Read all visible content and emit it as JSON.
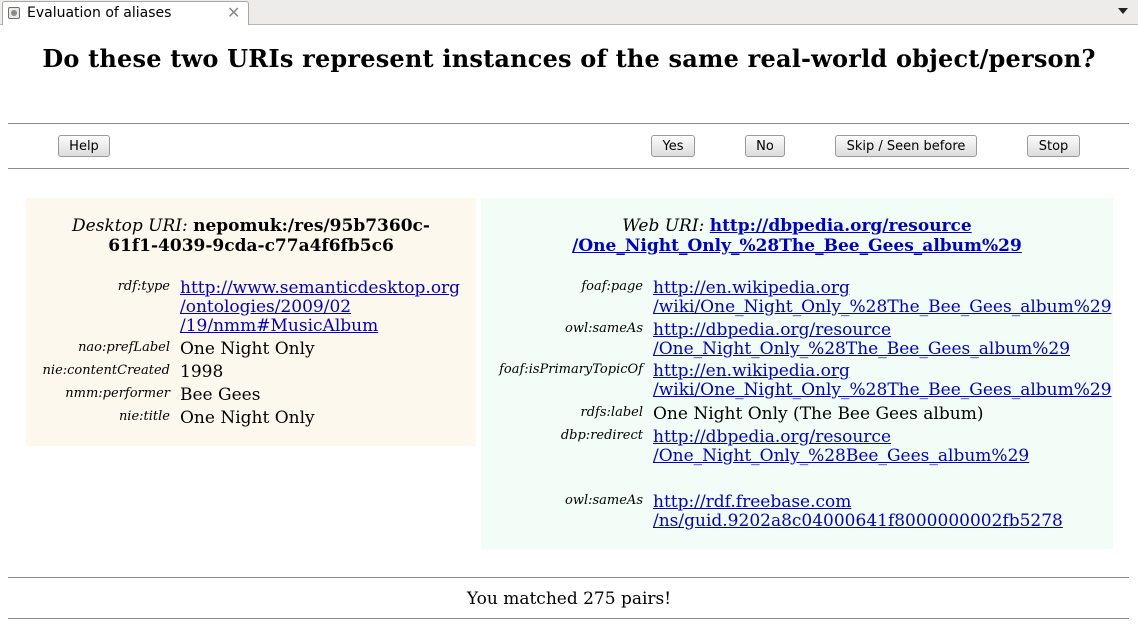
{
  "window": {
    "tab_title": "Evaluation of aliases",
    "close_icon": "close-icon",
    "menu_icon": "chevron-down-icon"
  },
  "question": "Do these two URIs represent instances of the same real-world object/person?",
  "toolbar": {
    "help": "Help",
    "yes": "Yes",
    "no": "No",
    "skip": "Skip / Seen before",
    "stop": "Stop"
  },
  "desktop": {
    "label": "Desktop URI:",
    "uri_line1": "nepomuk:/res/95b7360c-",
    "uri_line2": "61f1-4039-9cda-c77a4f6fb5c6",
    "properties": [
      {
        "label": "rdf:type",
        "lines": [
          "http://www.semanticdesktop.org",
          "/ontologies/2009/02",
          "/19/nmm#MusicAlbum"
        ],
        "link": true
      },
      {
        "label": "nao:prefLabel",
        "lines": [
          "One Night Only"
        ],
        "link": false
      },
      {
        "label": "nie:contentCreated",
        "lines": [
          "1998"
        ],
        "link": false
      },
      {
        "label": "nmm:performer",
        "lines": [
          "Bee Gees"
        ],
        "link": false
      },
      {
        "label": "nie:title",
        "lines": [
          "One Night Only"
        ],
        "link": false
      }
    ]
  },
  "web": {
    "label": "Web URI:",
    "uri_line1": "http://dbpedia.org/resource",
    "uri_line2": "/One_Night_Only_%28The_Bee_Gees_album%29",
    "properties": [
      {
        "label": "foaf:page",
        "lines": [
          "http://en.wikipedia.org",
          "/wiki/One_Night_Only_%28The_Bee_Gees_album%29"
        ],
        "link": true
      },
      {
        "label": "owl:sameAs",
        "lines": [
          "http://dbpedia.org/resource",
          "/One_Night_Only_%28The_Bee_Gees_album%29"
        ],
        "link": true
      },
      {
        "label": "foaf:isPrimaryTopicOf",
        "lines": [
          "http://en.wikipedia.org",
          "/wiki/One_Night_Only_%28The_Bee_Gees_album%29"
        ],
        "link": true
      },
      {
        "label": "rdfs:label",
        "lines": [
          "One Night Only (The Bee Gees album)"
        ],
        "link": false
      },
      {
        "label": "dbp:redirect",
        "lines": [
          "http://dbpedia.org/resource",
          "/One_Night_Only_%28Bee_Gees_album%29"
        ],
        "link": true
      },
      {
        "label": "owl:sameAs",
        "lines": [
          "http://rdf.freebase.com",
          "/ns/guid.9202a8c04000641f8000000002fb5278"
        ],
        "link": true
      }
    ]
  },
  "status": "You matched 275 pairs!"
}
